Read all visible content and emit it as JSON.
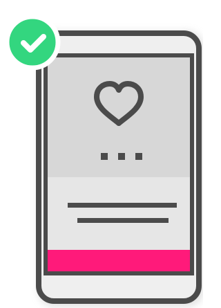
{
  "illustration": {
    "subject": "phone-with-heart-icon",
    "colors": {
      "outline": "#4b4b4b",
      "screen_top": "#d7d7d7",
      "screen_band": "#e6e6e6",
      "accent_bar": "#ff1a7a",
      "check_badge": "#33d67f",
      "check_mark": "#ffffff"
    },
    "icons": {
      "badge": "checkmark-circle-icon",
      "heart": "heart-icon",
      "dots": "more-dots-icon"
    }
  }
}
